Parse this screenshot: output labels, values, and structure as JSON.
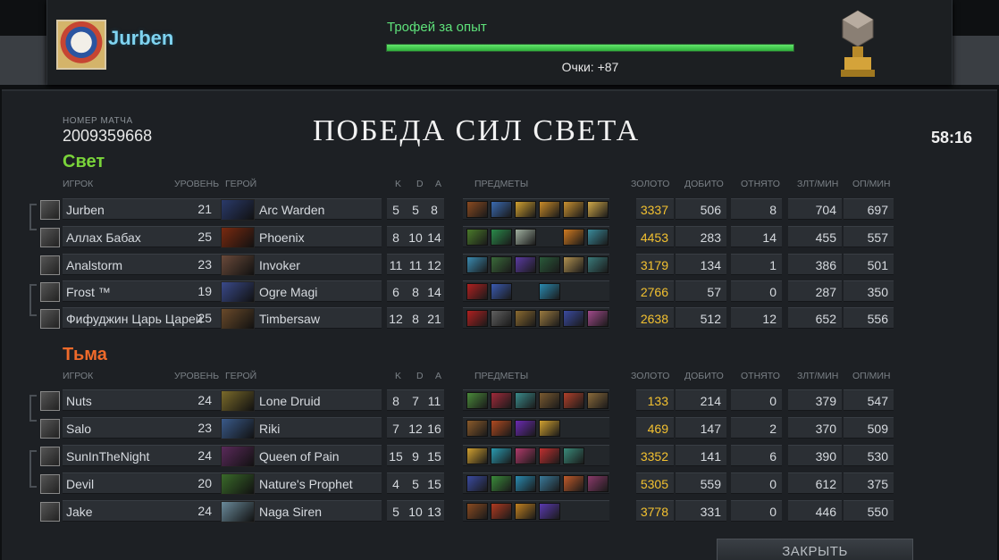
{
  "header": {
    "username": "Jurben",
    "trophy_title": "Трофей за опыт",
    "progress": 1.0,
    "points_text": "Очки: +87"
  },
  "match": {
    "number_label": "НОМЕР МАТЧА",
    "number": "2009359668",
    "result": "ПОБЕДА СИЛ СВЕТА",
    "duration": "58:16"
  },
  "columns": {
    "player": "ИГРОК",
    "level": "УРОВЕНЬ",
    "hero": "ГЕРОЙ",
    "k": "K",
    "d": "D",
    "a": "A",
    "items": "ПРЕДМЕТЫ",
    "gold": "ЗОЛОТО",
    "last_hits": "ДОБИТО",
    "denies": "ОТНЯТО",
    "gpm": "ЗЛТ/МИН",
    "xpm": "ОП/МИН"
  },
  "radiant": {
    "name": "Свет",
    "color": "#7ad43a",
    "players": [
      {
        "name": "Jurben",
        "level": "21",
        "hero": "Arc Warden",
        "k": "5",
        "d": "5",
        "a": "8",
        "gold": "3337",
        "lh": "506",
        "dn": "8",
        "gpm": "704",
        "xpm": "697",
        "items": [
          "#8a4a20",
          "#3a6ab0",
          "#d0a030",
          "#c88a28",
          "#c89030",
          "#d0a848"
        ]
      },
      {
        "name": "Аллах Бабах",
        "level": "25",
        "hero": "Phoenix",
        "k": "8",
        "d": "10",
        "a": "14",
        "gold": "4453",
        "lh": "283",
        "dn": "14",
        "gpm": "455",
        "xpm": "557",
        "items": [
          "#4a7a2a",
          "#2a8a4a",
          "#a0b0a0",
          "",
          "#d07a20",
          "#3a8a9a"
        ]
      },
      {
        "name": "Analstorm",
        "level": "23",
        "hero": "Invoker",
        "k": "11",
        "d": "11",
        "a": "12",
        "gold": "3179",
        "lh": "134",
        "dn": "1",
        "gpm": "386",
        "xpm": "501",
        "items": [
          "#3a8ab0",
          "#3a6a3a",
          "#5a3aa0",
          "#2a5a3a",
          "#b09050",
          "#3a7a7a"
        ]
      },
      {
        "name": "Frost ™",
        "level": "19",
        "hero": "Ogre Magi",
        "k": "6",
        "d": "8",
        "a": "14",
        "gold": "2766",
        "lh": "57",
        "dn": "0",
        "gpm": "287",
        "xpm": "350",
        "items": [
          "#b02020",
          "#3a5ab0",
          "",
          "#2a8ab0",
          "",
          ""
        ]
      },
      {
        "name": "Фифуджин Царь Царей",
        "level": "25",
        "hero": "Timbersaw",
        "k": "12",
        "d": "8",
        "a": "21",
        "gold": "2638",
        "lh": "512",
        "dn": "12",
        "gpm": "652",
        "xpm": "556",
        "items": [
          "#b02020",
          "#606060",
          "#8a6a30",
          "#9a7a40",
          "#3a4aa0",
          "#a04a8a"
        ]
      }
    ]
  },
  "dire": {
    "name": "Тьма",
    "color": "#f06a2a",
    "players": [
      {
        "name": "Nuts",
        "level": "24",
        "hero": "Lone Druid",
        "k": "8",
        "d": "7",
        "a": "11",
        "gold": "133",
        "lh": "214",
        "dn": "0",
        "gpm": "379",
        "xpm": "547",
        "items": [
          "#4a8a3a",
          "#a02a3a",
          "#3a8a8a",
          "#7a5a30",
          "#b0402a",
          "#8a6a3a"
        ]
      },
      {
        "name": "Salo",
        "level": "23",
        "hero": "Riki",
        "k": "7",
        "d": "12",
        "a": "16",
        "gold": "469",
        "lh": "147",
        "dn": "2",
        "gpm": "370",
        "xpm": "509",
        "items": [
          "#8a5a2a",
          "#b04a20",
          "#6a2ab0",
          "#d0a030",
          "",
          ""
        ]
      },
      {
        "name": "SunInTheNight",
        "level": "24",
        "hero": "Queen of Pain",
        "k": "15",
        "d": "9",
        "a": "15",
        "gold": "3352",
        "lh": "141",
        "dn": "6",
        "gpm": "390",
        "xpm": "530",
        "items": [
          "#d0a030",
          "#2a9ab0",
          "#b03a6a",
          "#c03030",
          "#3a8a7a",
          ""
        ]
      },
      {
        "name": "Devil",
        "level": "20",
        "hero": "Nature's Prophet",
        "k": "4",
        "d": "5",
        "a": "15",
        "gold": "5305",
        "lh": "559",
        "dn": "0",
        "gpm": "612",
        "xpm": "375",
        "items": [
          "#3a4aa0",
          "#3a8a3a",
          "#2a8ab0",
          "#3a7a9a",
          "#c05a2a",
          "#8a3a6a"
        ]
      },
      {
        "name": "Jake",
        "level": "24",
        "hero": "Naga Siren",
        "k": "5",
        "d": "10",
        "a": "13",
        "gold": "3778",
        "lh": "331",
        "dn": "0",
        "gpm": "446",
        "xpm": "550",
        "items": [
          "#8a4a20",
          "#b03a20",
          "#c08020",
          "#5a3ab0",
          "",
          ""
        ]
      }
    ]
  },
  "close_button": "ЗАКРЫТЬ"
}
